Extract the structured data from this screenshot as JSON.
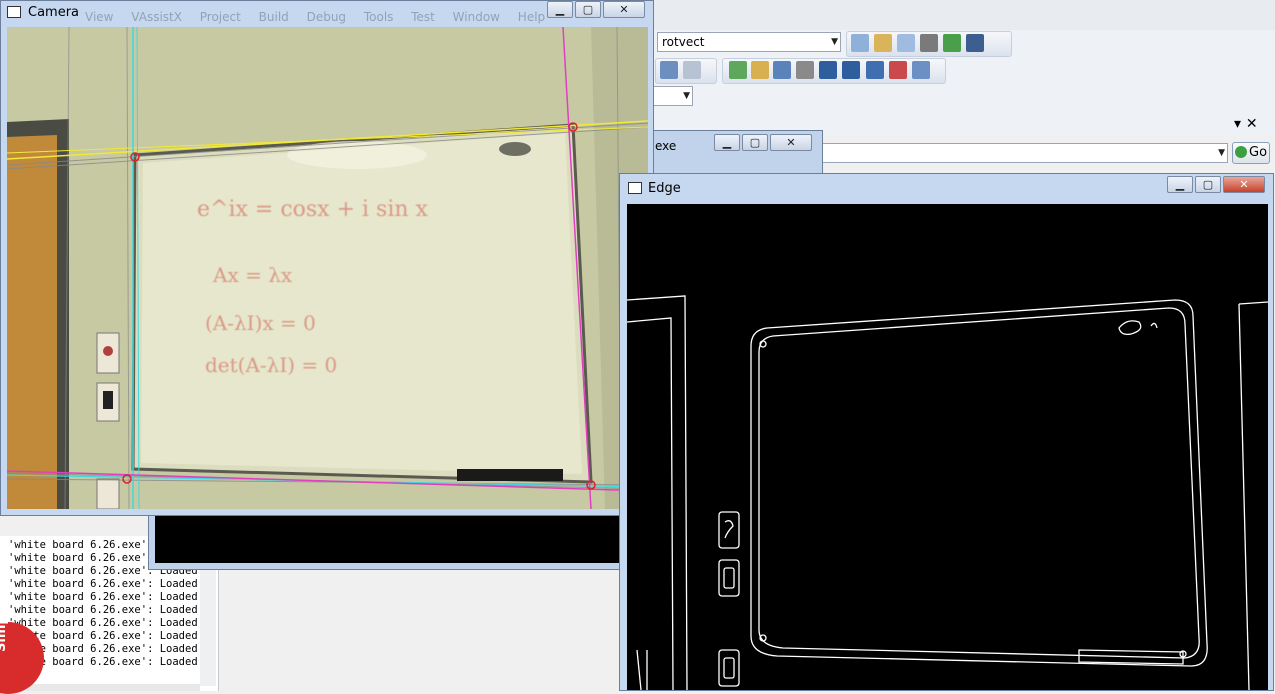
{
  "ide": {
    "menu_ghost": "View  VAssistX  Project  Build  Debug  Tools  Test  Window  Help",
    "find_combo_value": "rotvect",
    "command_combo_value": "",
    "go_button_label": "Go",
    "small_combo_value": ""
  },
  "output": {
    "lines": [
      "'white board 6.26.exe': ",
      "'white board 6.26.exe': Loaded '",
      "'white board 6.26.exe': Loaded '",
      "'white board 6.26.exe': Loaded '",
      "'white board 6.26.exe': Loaded '",
      "'white board 6.26.exe': Loaded '",
      "'white board 6.26.exe': Loaded '",
      "'white board 6.26.exe': Loaded '",
      "'white board 6.26.exe': Loaded '",
      "'white board 6.26.exe': Loaded '"
    ]
  },
  "simpletap": {
    "label": "SimpleTap"
  },
  "exe_window": {
    "title": "exe"
  },
  "camera_window": {
    "title": "Camera",
    "whiteboard_lines": [
      "e^ix = cosx + i sin x",
      "Ax = λx",
      "(A-λI)x = 0",
      "det(A-λI) = 0"
    ]
  },
  "edge_window": {
    "title": "Edge"
  },
  "icons": {
    "minimize": "minimize-icon",
    "maximize": "maximize-icon",
    "close": "close-icon"
  },
  "colors": {
    "window_frame": "#c5d8ef",
    "close_button": "#c7402a",
    "detected_line_yellow": "#f2e83a",
    "detected_line_magenta": "#e040c0",
    "detected_line_cyan": "#40d8e0"
  }
}
